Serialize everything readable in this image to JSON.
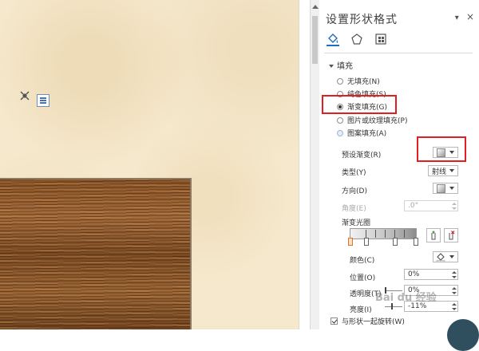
{
  "pane": {
    "title": "设置形状格式",
    "dropdown_glyph": "▾",
    "close_glyph": "×",
    "tabs": [
      {
        "name": "fill-line",
        "icon": "paint-bucket-icon"
      },
      {
        "name": "effects",
        "icon": "pentagon-icon"
      },
      {
        "name": "layout-properties",
        "icon": "size-properties-icon"
      }
    ],
    "fill_section": "填充",
    "fill_options": [
      {
        "label": "无填充(N)",
        "checked": false
      },
      {
        "label": "纯色填充(S)",
        "checked": false
      },
      {
        "label": "渐变填充(G)",
        "checked": true
      },
      {
        "label": "图片或纹理填充(P)",
        "checked": false
      },
      {
        "label": "图案填充(A)",
        "checked": false
      }
    ],
    "preset_gradient_label": "预设渐变(R)",
    "type_label": "类型(Y)",
    "type_value": "射线",
    "direction_label": "方向(D)",
    "angle_label": "角度(E)",
    "angle_value": ".0°",
    "gradient_stops_label": "渐变光圈",
    "color_label": "颜色(C)",
    "position_label": "位置(O)",
    "position_value": "0%",
    "transparency_label": "透明度(T)",
    "transparency_value": "0%",
    "brightness_label": "亮度(I)",
    "brightness_value": "-11%",
    "rotate_with_shape_label": "与形状一起旋转(W)",
    "rotate_with_shape_checked": true
  },
  "watermark": "Bai du 经验",
  "colors": {
    "highlight": "#e02020",
    "accent": "#1f6fbf",
    "parchment": "#f5e8cc",
    "wood": "#8a5426"
  }
}
